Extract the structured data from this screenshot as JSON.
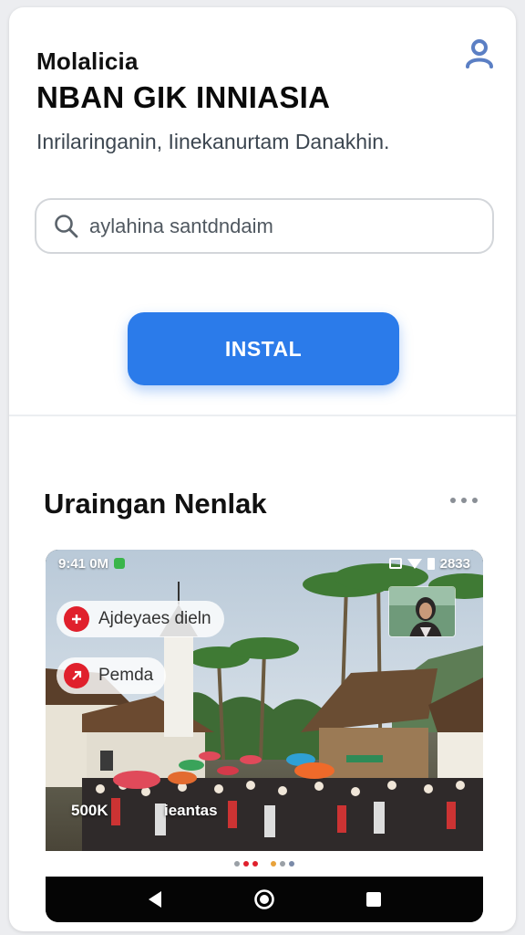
{
  "header": {
    "brand_small": "Molalicia",
    "brand_big": "NBAN GIK INNIASIA",
    "subtitle": "Inrilaringanin, Iinekanurtam Danakhin."
  },
  "search": {
    "placeholder": "aylahina santdndaim",
    "value": ""
  },
  "install_button": {
    "label": "INSTAL"
  },
  "section": {
    "title": "Uraingan Nenlak"
  },
  "screenshot_preview": {
    "status_time": "9:41 0M",
    "status_right": "2833",
    "chips": [
      {
        "label": "Ajdeyaes dieln"
      },
      {
        "label": "Pemda"
      }
    ],
    "overlay_labels": [
      "500K",
      "ieantas"
    ]
  },
  "icons": {
    "profile": "user-icon",
    "search": "search-icon",
    "more": "more-horizontal-icon",
    "back": "back-triangle-icon",
    "home": "home-circle-icon",
    "recents": "recents-square-icon"
  },
  "colors": {
    "accent": "#2b7bea",
    "profile_icon": "#5b7fc4",
    "chip_dot": "#e0202c"
  }
}
